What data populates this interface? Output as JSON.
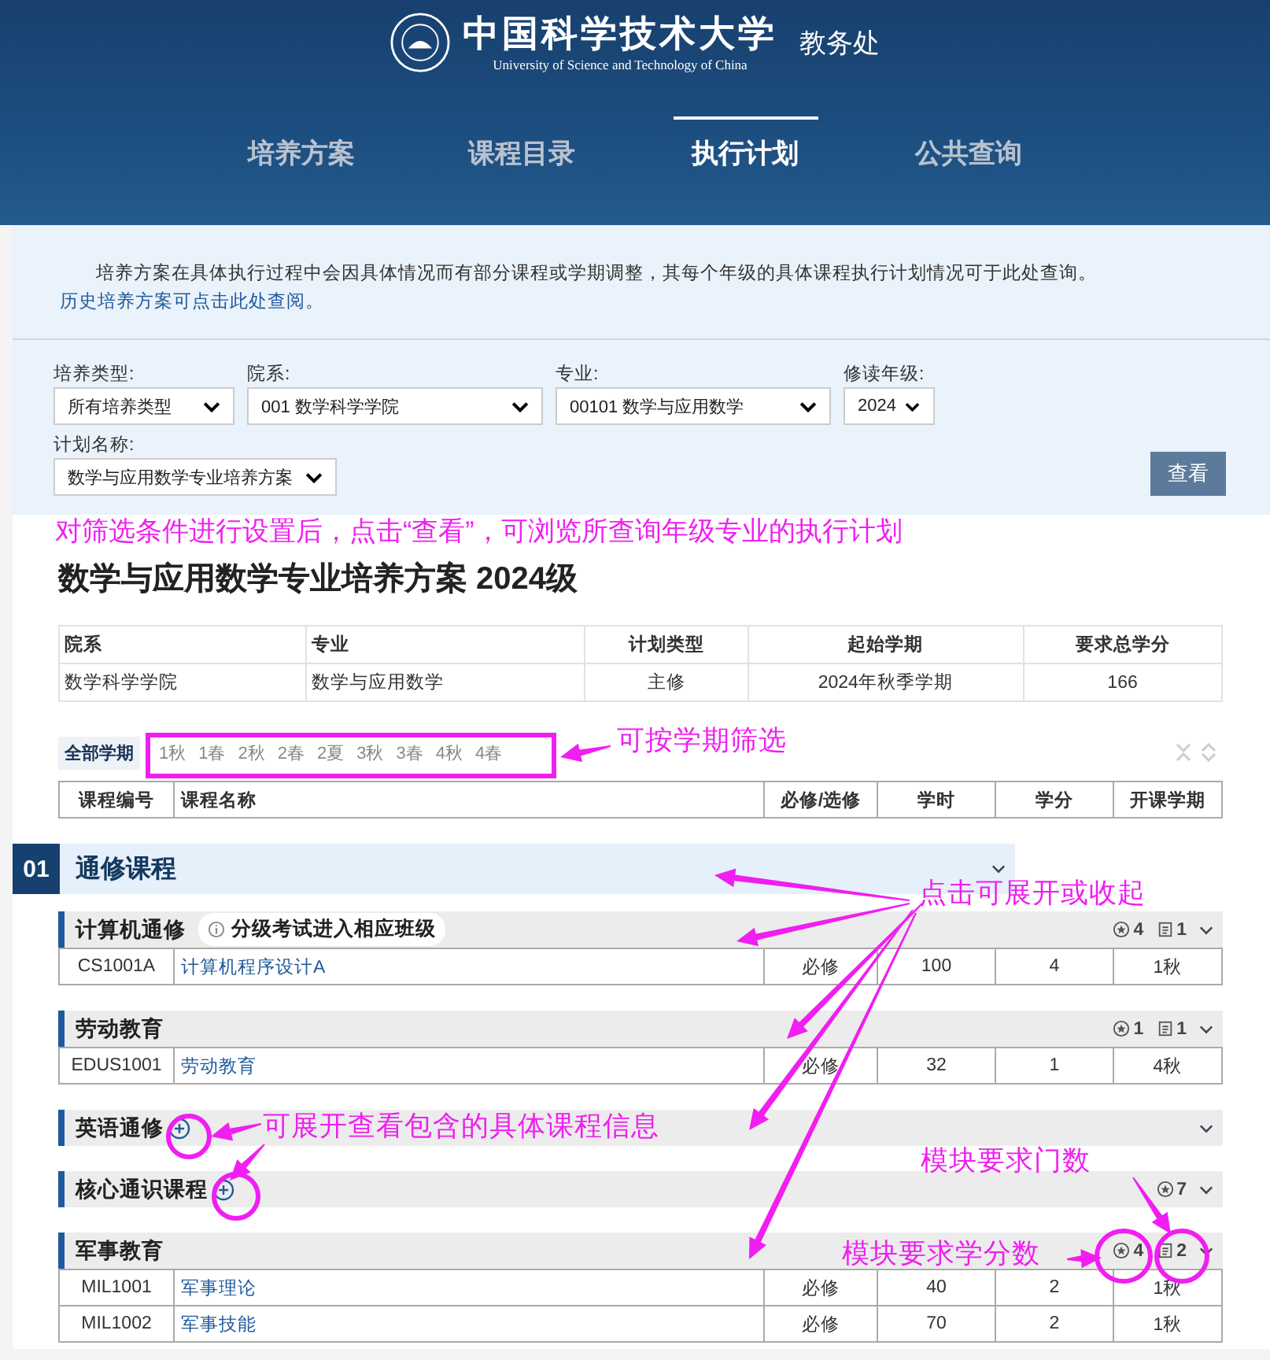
{
  "header": {
    "title": "中国科学技术大学",
    "subtitle": "University of Science and Technology of China",
    "office": "教务处"
  },
  "tabs": [
    {
      "label": "培养方案",
      "selected": false
    },
    {
      "label": "课程目录",
      "selected": false
    },
    {
      "label": "执行计划",
      "selected": true
    },
    {
      "label": "公共查询",
      "selected": false
    }
  ],
  "notice": {
    "text": "培养方案在具体执行过程中会因具体情况而有部分课程或学期调整，其每个年级的具体课程执行计划情况可于此处查询。",
    "link": "历史培养方案可点击此处查阅。"
  },
  "filters": [
    {
      "label": "培养类型:",
      "value": "所有培养类型"
    },
    {
      "label": "院系:",
      "value": "001 数学科学学院"
    },
    {
      "label": "专业:",
      "value": "00101 数学与应用数学"
    },
    {
      "label": "修读年级:",
      "value": "2024"
    },
    {
      "label": "计划名称:",
      "value": "数学与应用数学专业培养方案"
    }
  ],
  "search_button": "查看",
  "plan_title": "数学与应用数学专业培养方案 2024级",
  "info_table": {
    "columns": [
      "院系",
      "专业",
      "计划类型",
      "起始学期",
      "要求总学分"
    ],
    "row": [
      "数学科学学院",
      "数学与应用数学",
      "主修",
      "2024年秋季学期",
      "166"
    ]
  },
  "semesters": [
    {
      "label": "全部学期",
      "selected": true
    },
    {
      "label": "1秋",
      "selected": false
    },
    {
      "label": "1春",
      "selected": false
    },
    {
      "label": "2秋",
      "selected": false
    },
    {
      "label": "2春",
      "selected": false
    },
    {
      "label": "2夏",
      "selected": false
    },
    {
      "label": "3秋",
      "selected": false
    },
    {
      "label": "3春",
      "selected": false
    },
    {
      "label": "4秋",
      "selected": false
    },
    {
      "label": "4春",
      "selected": false
    }
  ],
  "course_columns": [
    "课程编号",
    "课程名称",
    "必修/选修",
    "学时",
    "学分",
    "开课学期"
  ],
  "section": {
    "number": "01",
    "title": "通修课程",
    "expanded": true,
    "modules": [
      {
        "name": "计算机通修",
        "note": "分级考试进入相应班级",
        "credits": "4",
        "count": "1",
        "expanded": true,
        "courses": [
          {
            "code": "CS1001A",
            "name": "计算机程序设计A",
            "type": "必修",
            "hours": "100",
            "credits": "4",
            "semester": "1秋"
          }
        ]
      },
      {
        "name": "劳动教育",
        "credits": "1",
        "count": "1",
        "expanded": true,
        "courses": [
          {
            "code": "EDUS1001",
            "name": "劳动教育",
            "type": "必修",
            "hours": "32",
            "credits": "1",
            "semester": "4秋"
          }
        ]
      },
      {
        "name": "英语通修",
        "expanded": false
      },
      {
        "name": "核心通识课程",
        "credits": "7",
        "expanded": false
      },
      {
        "name": "军事教育",
        "credits": "4",
        "count": "2",
        "expanded": true,
        "courses": [
          {
            "code": "MIL1001",
            "name": "军事理论",
            "type": "必修",
            "hours": "40",
            "credits": "2",
            "semester": "1秋"
          },
          {
            "code": "MIL1002",
            "name": "军事技能",
            "type": "必修",
            "hours": "70",
            "credits": "2",
            "semester": "1秋"
          }
        ]
      }
    ]
  },
  "annotations": [
    "对筛选条件进行设置后，点击“查看”，可浏览所查询年级专业的执行计划",
    "可按学期筛选",
    "点击可展开或收起",
    "可展开查看包含的具体课程信息",
    "模块要求门数",
    "模块要求学分数"
  ]
}
